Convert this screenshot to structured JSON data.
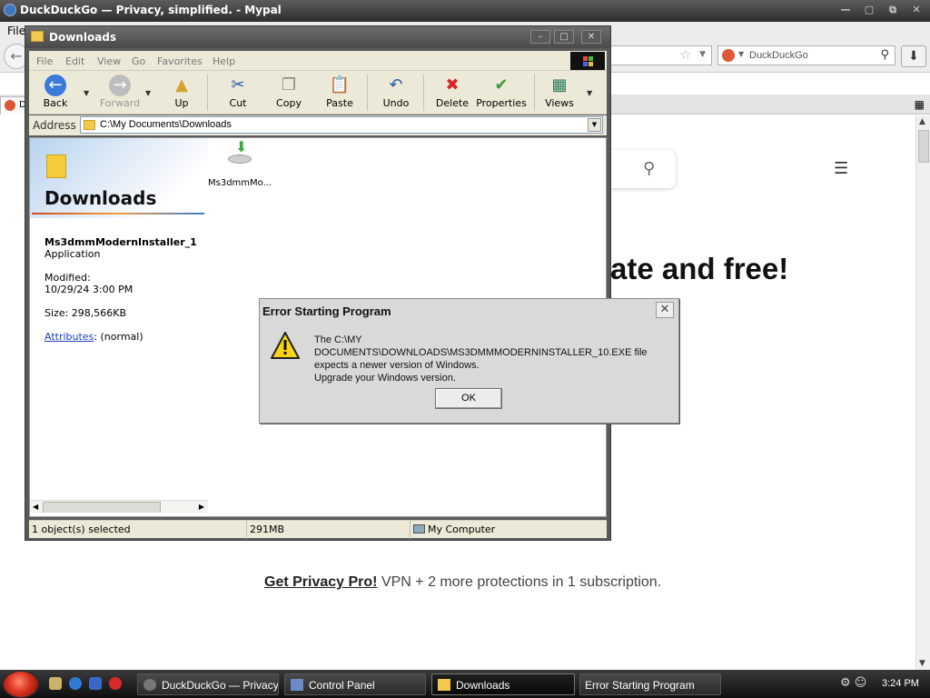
{
  "browser": {
    "title": "DuckDuckGo — Privacy, simplified. - Mypal",
    "menu_file": "File",
    "search_engine_text": "DuckDuckGo",
    "tab_left_text": "D",
    "page": {
      "headline_partial": "ate and free!",
      "privacy_link": "Get Privacy Pro!",
      "privacy_text": " VPN + 2 more protections in 1 subscription."
    }
  },
  "explorer": {
    "title": "Downloads",
    "menu": [
      "File",
      "Edit",
      "View",
      "Go",
      "Favorites",
      "Help"
    ],
    "toolbar": {
      "back": "Back",
      "forward": "Forward",
      "up": "Up",
      "cut": "Cut",
      "copy": "Copy",
      "paste": "Paste",
      "undo": "Undo",
      "delete": "Delete",
      "properties": "Properties",
      "views": "Views"
    },
    "address_label": "Address",
    "address_value": "C:\\My Documents\\Downloads",
    "left_pane": {
      "heading": "Downloads",
      "file_name": "Ms3dmmModernInstaller_1",
      "file_type": "Application",
      "modified_label": "Modified:",
      "modified_value": "10/29/24 3:00 PM",
      "size": "Size: 298,566KB",
      "attributes_link": "Attributes",
      "attributes_value": ": (normal)"
    },
    "file_item_label": "Ms3dmmMo...",
    "status": {
      "selected": "1 object(s) selected",
      "size": "291MB",
      "location": "My Computer"
    }
  },
  "dialog": {
    "title": "Error Starting Program",
    "message_line1": "The C:\\MY DOCUMENTS\\DOWNLOADS\\MS3DMMMODERNINSTALLER_10.EXE file",
    "message_line2": "expects a newer version of Windows.",
    "message_line3": "Upgrade your Windows version.",
    "ok_label": "OK"
  },
  "taskbar": {
    "tasks": [
      "DuckDuckGo — Privacy...",
      "Control Panel",
      "Downloads",
      "Error Starting Program"
    ],
    "clock": "3:24 PM"
  }
}
